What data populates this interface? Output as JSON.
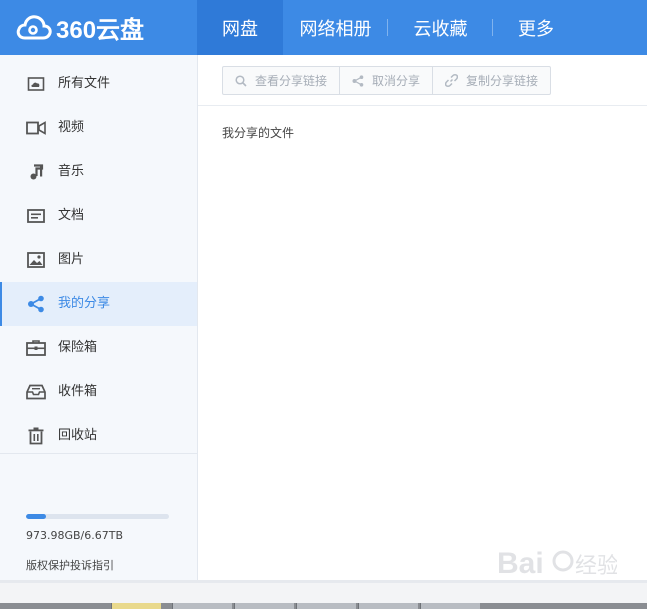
{
  "header": {
    "logo_text": "360云盘",
    "tabs": [
      {
        "label": "网盘",
        "active": true
      },
      {
        "label": "网络相册",
        "active": false
      },
      {
        "label": "云收藏",
        "active": false
      },
      {
        "label": "更多",
        "active": false
      }
    ]
  },
  "sidebar": {
    "items": [
      {
        "label": "所有文件",
        "icon": "cloud-folder-icon"
      },
      {
        "label": "视频",
        "icon": "video-camera-icon"
      },
      {
        "label": "音乐",
        "icon": "music-note-icon"
      },
      {
        "label": "文档",
        "icon": "document-icon"
      },
      {
        "label": "图片",
        "icon": "image-icon"
      },
      {
        "label": "我的分享",
        "icon": "share-icon",
        "active": true
      },
      {
        "label": "保险箱",
        "icon": "safe-box-icon"
      },
      {
        "label": "收件箱",
        "icon": "inbox-icon"
      },
      {
        "label": "回收站",
        "icon": "trash-icon"
      }
    ],
    "quota": {
      "text": "973.98GB/6.67TB",
      "used_fraction": 0.14
    },
    "report_link": "版权保护投诉指引"
  },
  "toolbar": {
    "view_share_link": "查看分享链接",
    "cancel_share": "取消分享",
    "copy_share_link": "复制分享链接"
  },
  "main": {
    "breadcrumb": "我分享的文件"
  },
  "colors": {
    "accent": "#3d8ae5",
    "header_active": "#2f7ad8",
    "sidebar_bg": "#f5f8fc",
    "active_item_bg": "#e4eefb"
  }
}
